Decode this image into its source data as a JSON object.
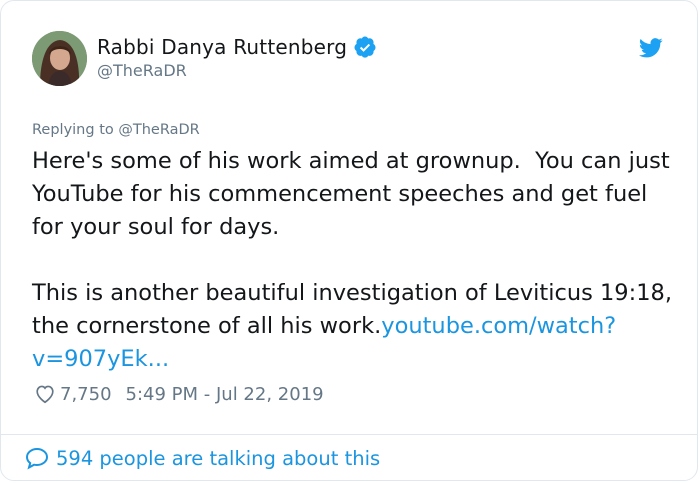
{
  "author": {
    "name": "Rabbi Danya Ruttenberg",
    "handle": "@TheRaDR",
    "verified_icon": "verified-badge-icon"
  },
  "reply": {
    "prefix": "Replying to ",
    "to": "@TheRaDR"
  },
  "tweet": {
    "paragraph1": "Here's some of his work aimed at grownup.  You can just YouTube for his commencement speeches and get fuel for your soul for days.",
    "paragraph2_text": "This is another beautiful investigation of Leviticus 19:18, the cornerstone of all his work.",
    "link_text": "youtube.com/watch?v=907yEk..."
  },
  "stats": {
    "likes": "7,750",
    "timestamp": "5:49 PM - Jul 22, 2019"
  },
  "footer": {
    "talking": "594 people are talking about this"
  },
  "colors": {
    "link": "#1b95e0",
    "muted": "#657786",
    "text": "#14171a",
    "twitter_blue": "#1da1f2"
  }
}
